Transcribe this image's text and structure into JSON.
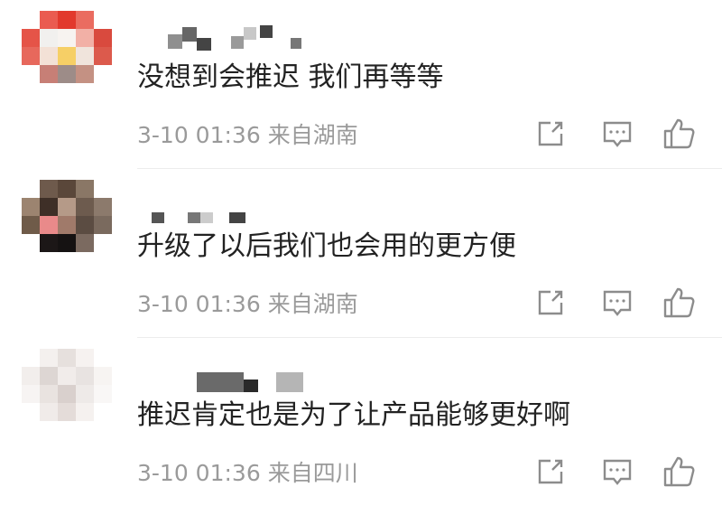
{
  "comments": [
    {
      "text": "没想到会推迟 我们再等等",
      "time": "3-10 01:36",
      "location": "来自湖南",
      "avatar_colors": [
        "#e24b3e",
        "#ffffff",
        "#5b8dd6"
      ],
      "actions": [
        "share-icon",
        "comment-icon",
        "thumbs-up-icon"
      ]
    },
    {
      "text": "升级了以后我们也会用的更方便",
      "time": "3-10 01:36",
      "location": "来自湖南",
      "avatar_colors": [
        "#5b4a3c",
        "#d9a28a",
        "#e07a7a"
      ],
      "actions": [
        "share-icon",
        "comment-icon",
        "thumbs-up-icon"
      ]
    },
    {
      "text": "推迟肯定也是为了让产品能够更好啊",
      "time": "3-10 01:36",
      "location": "来自四川",
      "avatar_colors": [
        "#e8e4e1",
        "#f5f0ee",
        "#d8cfcc"
      ],
      "actions": [
        "share-icon",
        "comment-icon",
        "thumbs-up-icon"
      ]
    }
  ],
  "colors": {
    "text": "#222222",
    "meta": "#9a9a9a",
    "icon": "#8c8c8c",
    "divider": "#ececec"
  }
}
